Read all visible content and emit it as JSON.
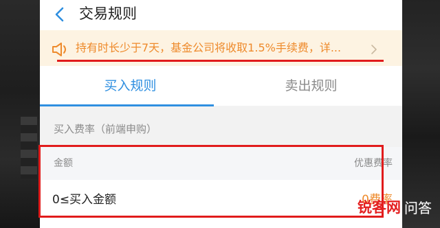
{
  "header": {
    "title": "交易规则",
    "back_icon": "chevron-left-icon"
  },
  "notice": {
    "icon": "speaker-icon",
    "text": "持有时长少于7天，基金公司将收取1.5%手续费，详...",
    "chevron_icon": "chevron-right-icon"
  },
  "tabs": [
    {
      "label": "买入规则",
      "active": true
    },
    {
      "label": "卖出规则",
      "active": false
    }
  ],
  "section": {
    "label": "买入费率（前端申购）"
  },
  "fee_table": {
    "headers": {
      "amount": "金额",
      "rate": "优惠费率"
    },
    "rows": [
      {
        "amount": "0≤买入金额",
        "rate": "0费率"
      }
    ]
  },
  "watermark": {
    "brand": "锐客网",
    "suffix": "问答"
  },
  "colors": {
    "accent_blue": "#2f8fe0",
    "notice_orange": "#ee8a2b",
    "annotation_red": "#e11b1b"
  }
}
